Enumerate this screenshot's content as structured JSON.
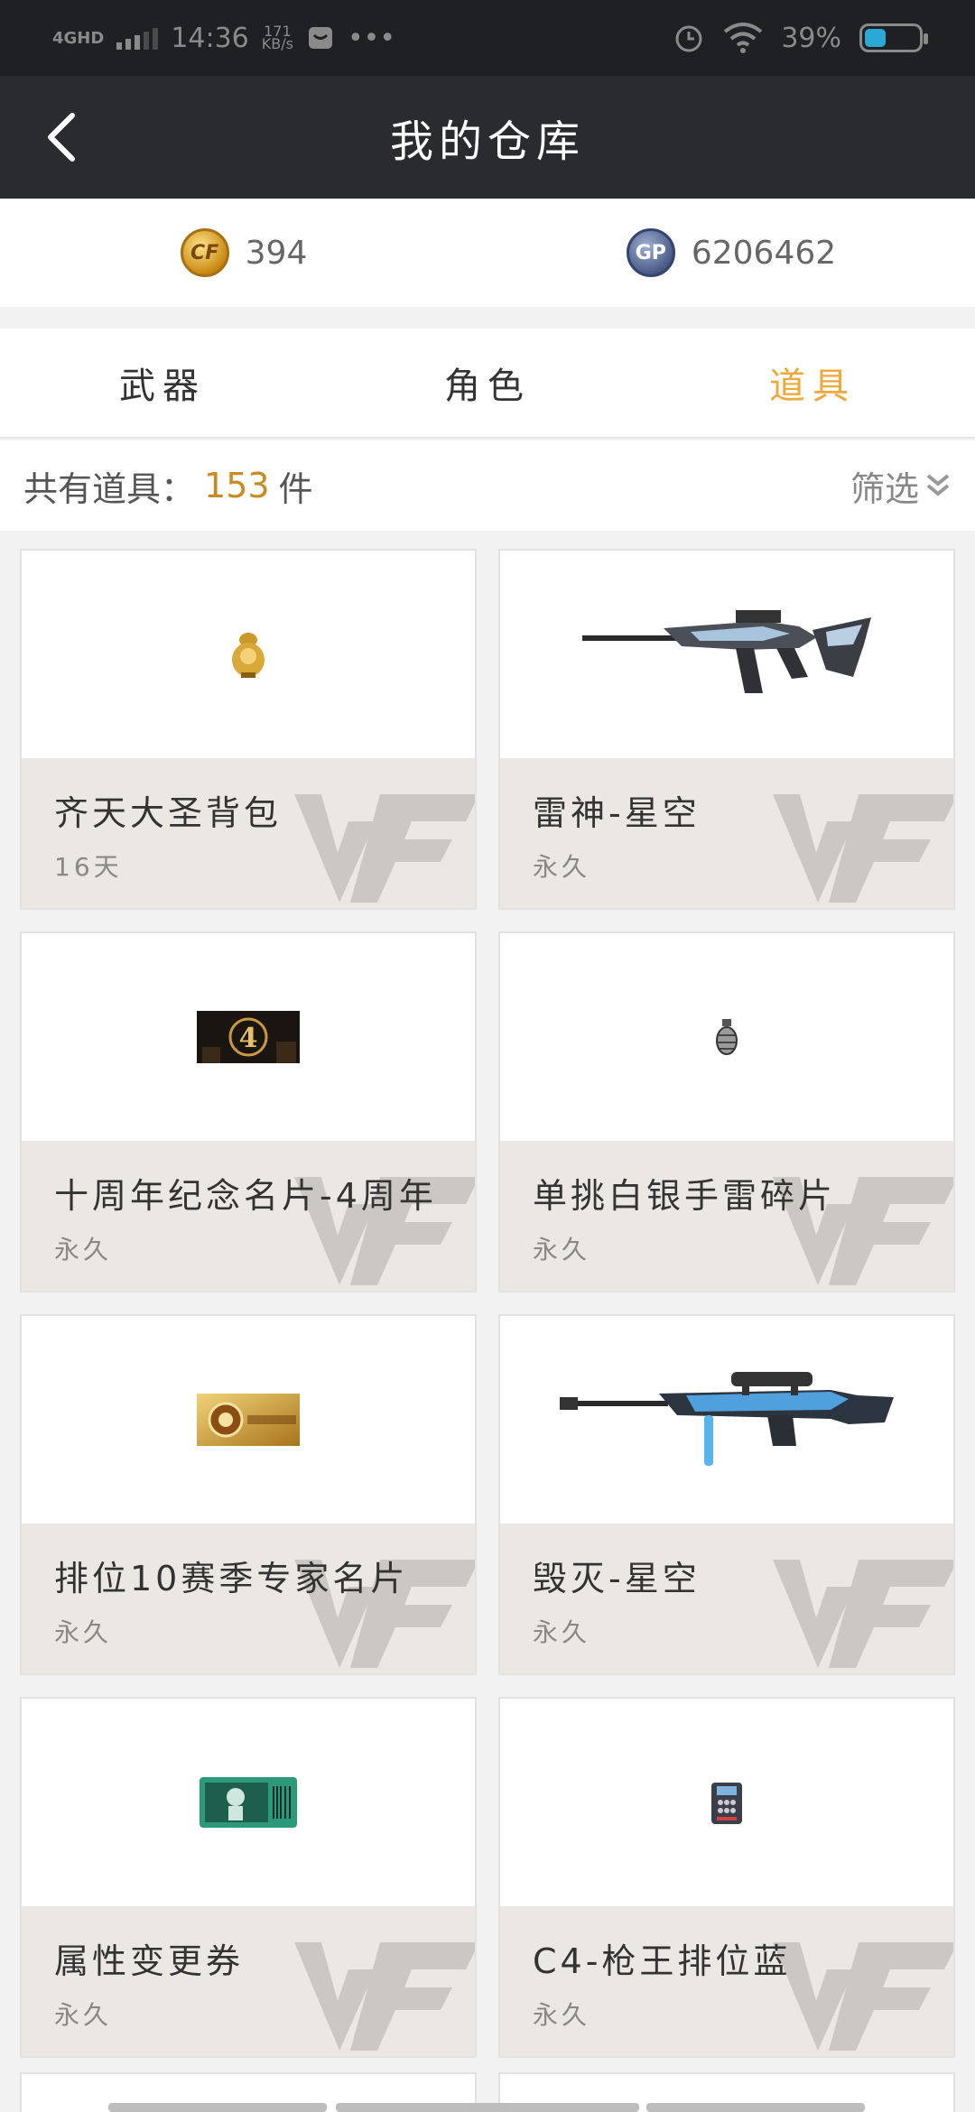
{
  "status_bar": {
    "network": "4GHD",
    "time": "14:36",
    "speed_value": "171",
    "speed_unit": "KB/s",
    "dots": "•••",
    "battery": "39%",
    "icons": [
      "signal-icon",
      "message-icon",
      "alarm-icon",
      "wifi-icon",
      "battery-icon"
    ]
  },
  "header": {
    "title": "我的仓库",
    "back_icon": "back-arrow-icon"
  },
  "currency": {
    "cf_icon_text": "CF",
    "cf_amount": "394",
    "gp_icon_text": "GP",
    "gp_amount": "6206462"
  },
  "tabs": [
    {
      "label": "武器",
      "active": false
    },
    {
      "label": "角色",
      "active": false
    },
    {
      "label": "道具",
      "active": true
    }
  ],
  "summary": {
    "prefix": "共有道具：",
    "count": "153",
    "suffix": "件",
    "filter_label": "筛选",
    "filter_icon": "double-chevron-down-icon"
  },
  "items": [
    {
      "name": "齐天大圣背包",
      "duration": "16天",
      "image": "backpack-icon"
    },
    {
      "name": "雷神-星空",
      "duration": "永久",
      "image": "rifle-icon"
    },
    {
      "name": "十周年纪念名片-4周年",
      "duration": "永久",
      "image": "card-4-icon"
    },
    {
      "name": "单挑白银手雷碎片",
      "duration": "永久",
      "image": "grenade-icon"
    },
    {
      "name": "排位10赛季专家名片",
      "duration": "永久",
      "image": "season-card-icon"
    },
    {
      "name": "毁灭-星空",
      "duration": "永久",
      "image": "sniper-icon"
    },
    {
      "name": "属性变更券",
      "duration": "永久",
      "image": "ticket-icon"
    },
    {
      "name": "C4-枪王排位蓝",
      "duration": "永久",
      "image": "c4-icon"
    }
  ],
  "colors": {
    "accent": "#f0a83a",
    "header_bg": "#2a2b2f",
    "card_info_bg": "#ebe8e4"
  }
}
